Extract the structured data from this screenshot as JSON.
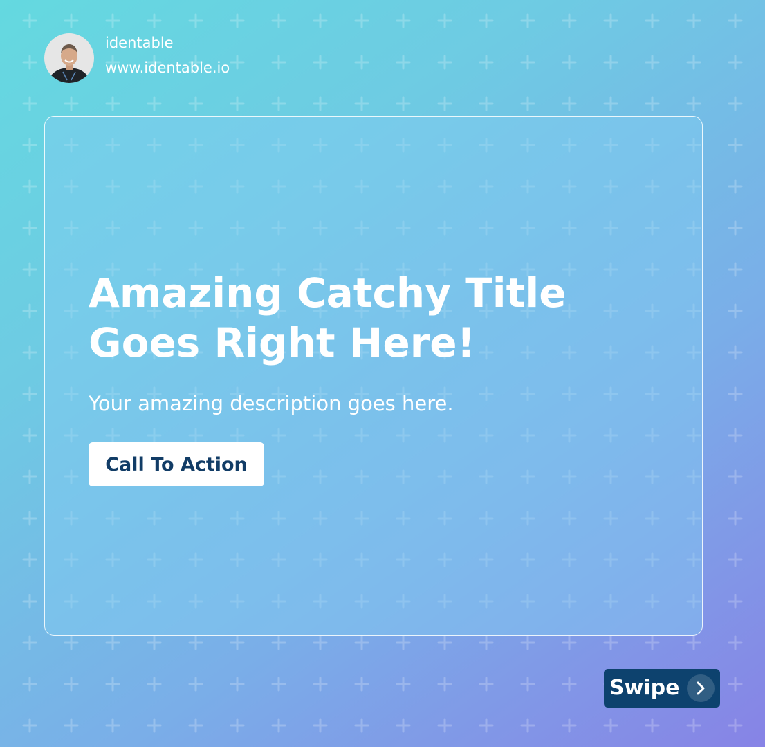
{
  "brand": {
    "name": "identable",
    "website": "www.identable.io"
  },
  "card": {
    "title_line1": "Amazing Catchy Title",
    "title_line2": "Goes Right Here!",
    "description": "Your amazing description goes here.",
    "cta_label": "Call To Action"
  },
  "swipe": {
    "label": "Swipe",
    "icon": "chevron-right-icon"
  },
  "colors": {
    "gradient_start": "#64d9e0",
    "gradient_end": "#8783e6",
    "button_text": "#113c66",
    "swipe_bg": "#0d426e"
  }
}
